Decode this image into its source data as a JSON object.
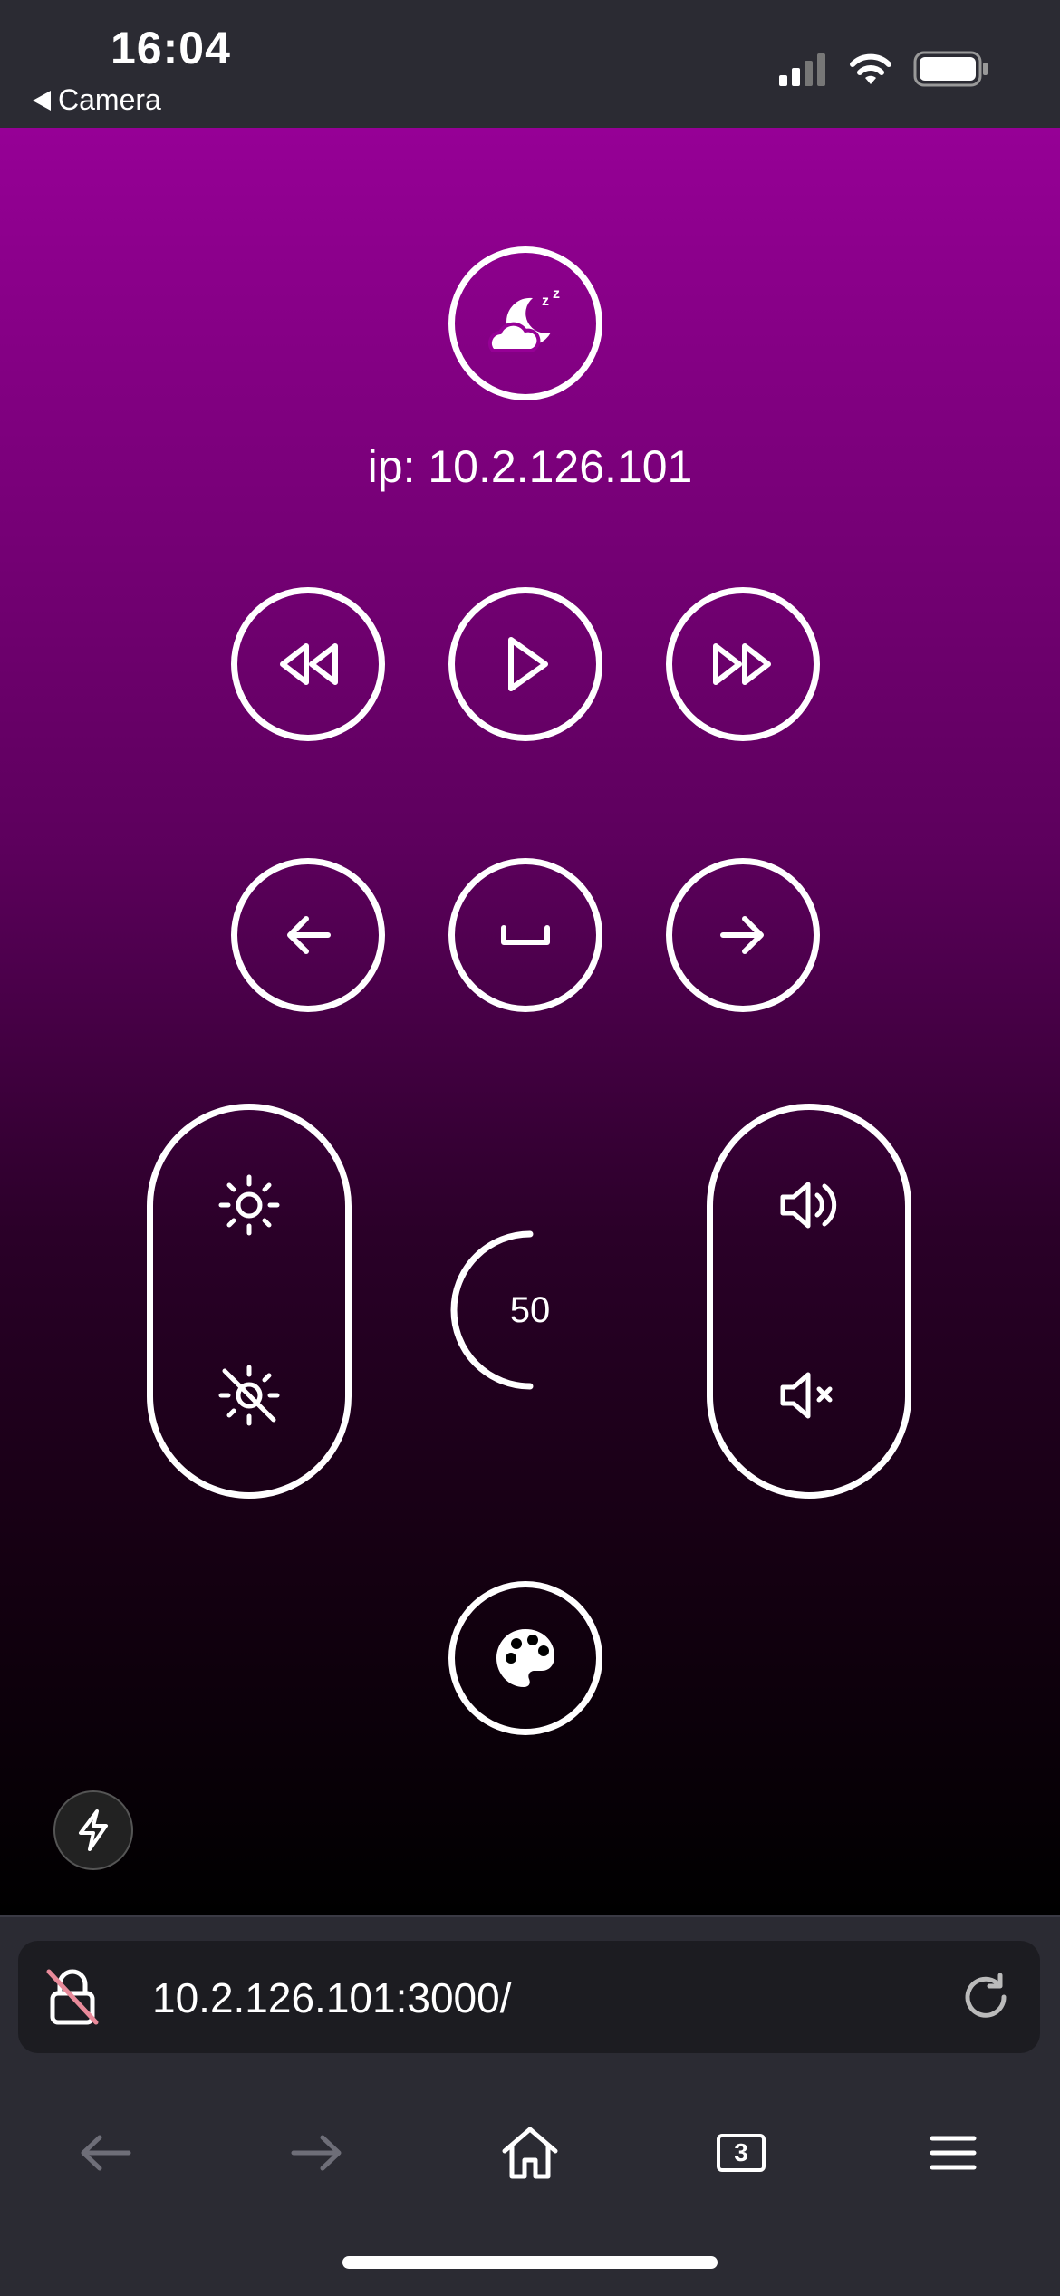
{
  "status_bar": {
    "time": "16:04",
    "back_label": "Camera"
  },
  "remote": {
    "ip_label": "ip: 10.2.126.101",
    "brightness_gauge_value": "50",
    "gauge_level_percent": 50,
    "icons": {
      "sleep": "moon-cloud-sleep-icon",
      "rewind": "rewind-icon",
      "play": "play-icon",
      "fast_forward": "fast-forward-icon",
      "left": "arrow-left-icon",
      "space": "space-bar-icon",
      "right": "arrow-right-icon",
      "brightness_up": "sun-icon",
      "brightness_off": "sun-off-icon",
      "volume_up": "volume-up-icon",
      "mute": "volume-mute-icon",
      "palette": "palette-icon",
      "flash": "lightning-icon"
    },
    "colors": {
      "gradient_top": "#960096",
      "gradient_bottom": "#000000"
    }
  },
  "browser": {
    "url": "10.2.126.101:3000/",
    "tab_count": "3"
  }
}
